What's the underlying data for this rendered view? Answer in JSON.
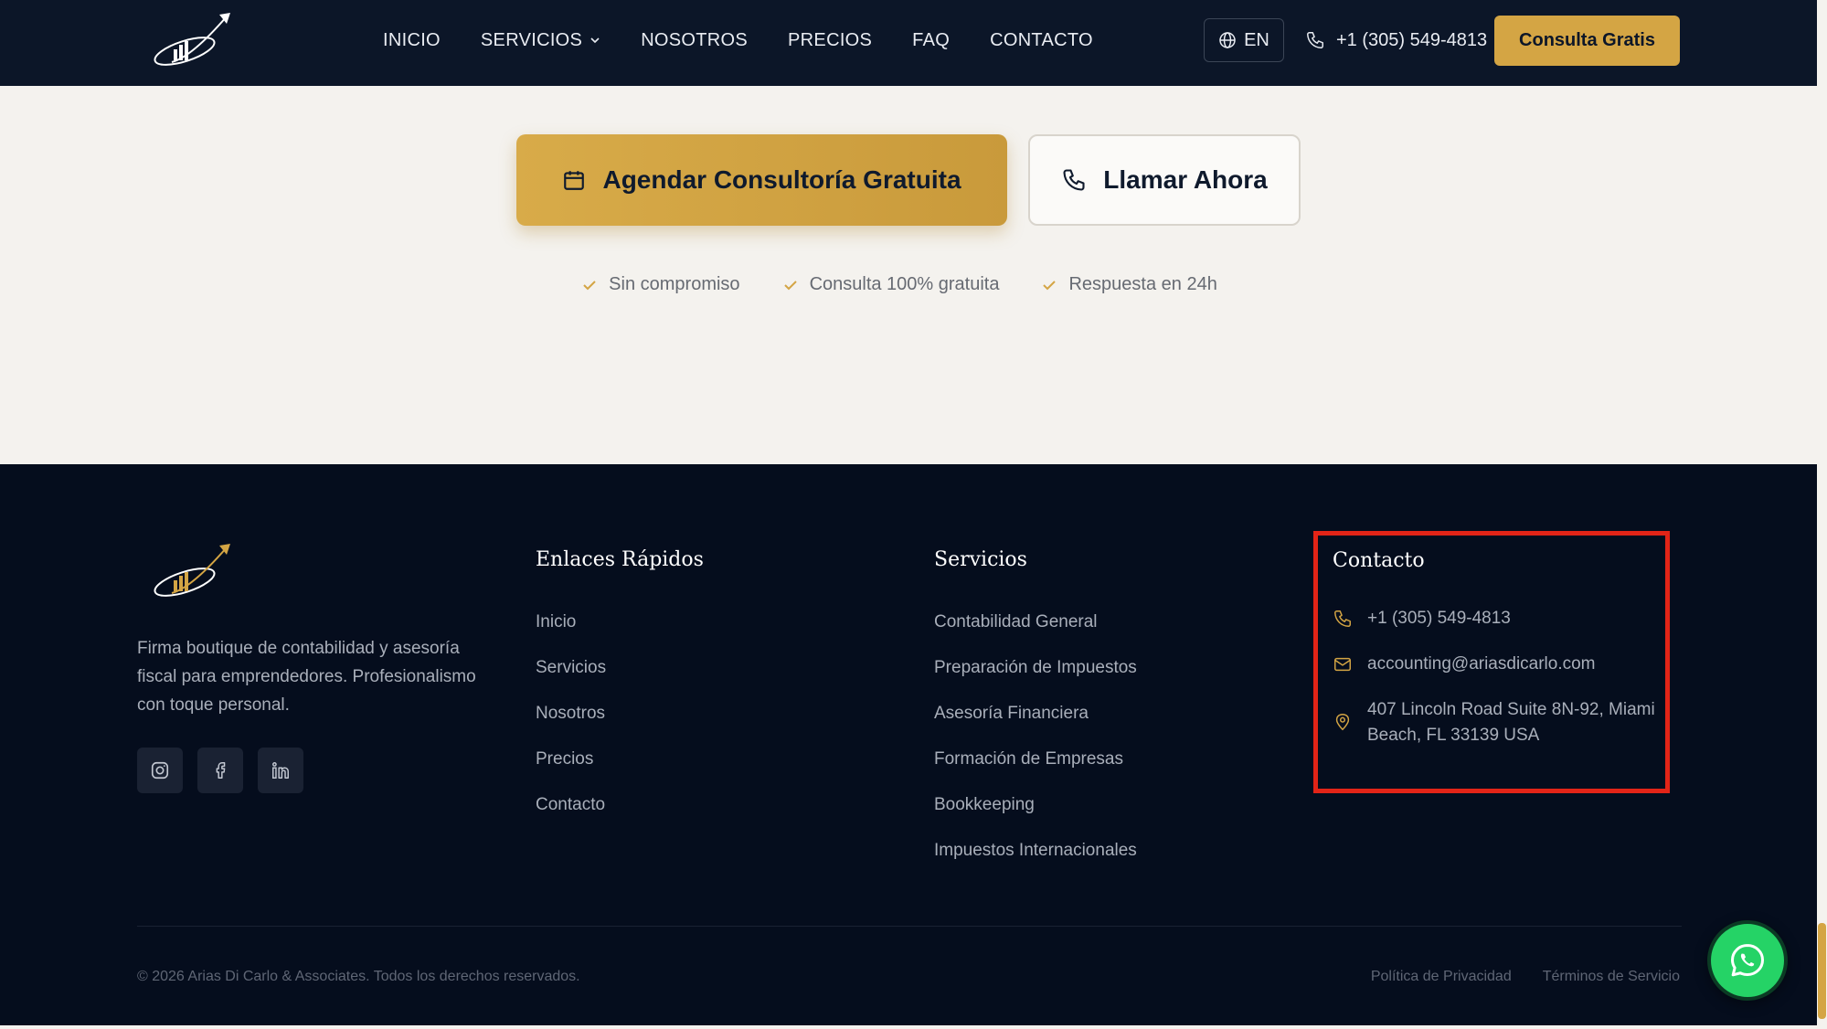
{
  "header": {
    "logo_icon": "logo-arrow-chart-icon",
    "nav": [
      {
        "label": "INICIO"
      },
      {
        "label": "SERVICIOS",
        "has_dropdown": true
      },
      {
        "label": "NOSOTROS"
      },
      {
        "label": "PRECIOS"
      },
      {
        "label": "FAQ"
      },
      {
        "label": "CONTACTO"
      }
    ],
    "language": "EN",
    "phone": "+1 (305) 549-4813",
    "cta_label": "Consulta Gratis"
  },
  "cta_section": {
    "primary_label": "Agendar Consultoría Gratuita",
    "secondary_label": "Llamar Ahora",
    "checks": [
      "Sin compromiso",
      "Consulta 100% gratuita",
      "Respuesta en 24h"
    ]
  },
  "footer": {
    "description": "Firma boutique de contabilidad y asesoría fiscal para emprendedores. Profesionalismo con toque personal.",
    "socials": [
      "instagram-icon",
      "facebook-icon",
      "linkedin-icon"
    ],
    "quick_links": {
      "title": "Enlaces Rápidos",
      "items": [
        "Inicio",
        "Servicios",
        "Nosotros",
        "Precios",
        "Contacto"
      ]
    },
    "services": {
      "title": "Servicios",
      "items": [
        "Contabilidad General",
        "Preparación de Impuestos",
        "Asesoría Financiera",
        "Formación de Empresas",
        "Bookkeeping",
        "Impuestos Internacionales"
      ]
    },
    "contact": {
      "title": "Contacto",
      "phone": "+1 (305) 549-4813",
      "email": "accounting@ariasdicarlo.com",
      "address_line1": "407 Lincoln Road Suite 8N-92, Miami",
      "address_line2": "Beach, FL 33139 USA"
    },
    "copyright": "© 2026 Arias Di Carlo & Associates. Todos los derechos reservados.",
    "legal": [
      "Política de Privacidad",
      "Términos de Servicio"
    ]
  },
  "colors": {
    "navy": "#0c1628",
    "footer_bg": "#050d1d",
    "gold": "#d4a544",
    "highlight": "#e32417",
    "whatsapp": "#25d366"
  }
}
